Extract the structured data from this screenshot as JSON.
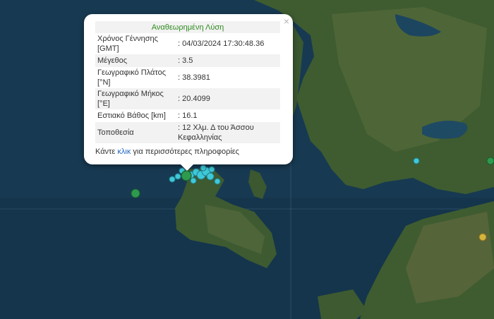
{
  "popup": {
    "title": "Αναθεωρημένη Λύση",
    "close_label": "×",
    "rows": [
      {
        "label": "Χρόνος Γέννησης [GMT]",
        "value": ": 04/03/2024 17:30:48.36"
      },
      {
        "label": "Μέγεθος",
        "value": ": 3.5"
      },
      {
        "label": "Γεωγραφικό Πλάτος [°N]",
        "value": ": 38.3981"
      },
      {
        "label": "Γεωγραφικό Μήκος [°E]",
        "value": ": 20.4099"
      },
      {
        "label": "Εστιακό Βάθος [km]",
        "value": ": 16.1"
      },
      {
        "label": "Τοποθεσία",
        "value": ": 12 Χλμ. Δ του Άσσου Κεφαλληνίας"
      }
    ],
    "footer_pre": "Κάντε ",
    "footer_link": "κλικ",
    "footer_post": " για περισσότερες πληροφορίες"
  },
  "map": {
    "sea_color": "#173a52",
    "land_color": "#3d5a2e",
    "marker_colors": {
      "cyan": "#3fc8d8",
      "green": "#2e9a4e",
      "yellow": "#d4b43a"
    }
  }
}
